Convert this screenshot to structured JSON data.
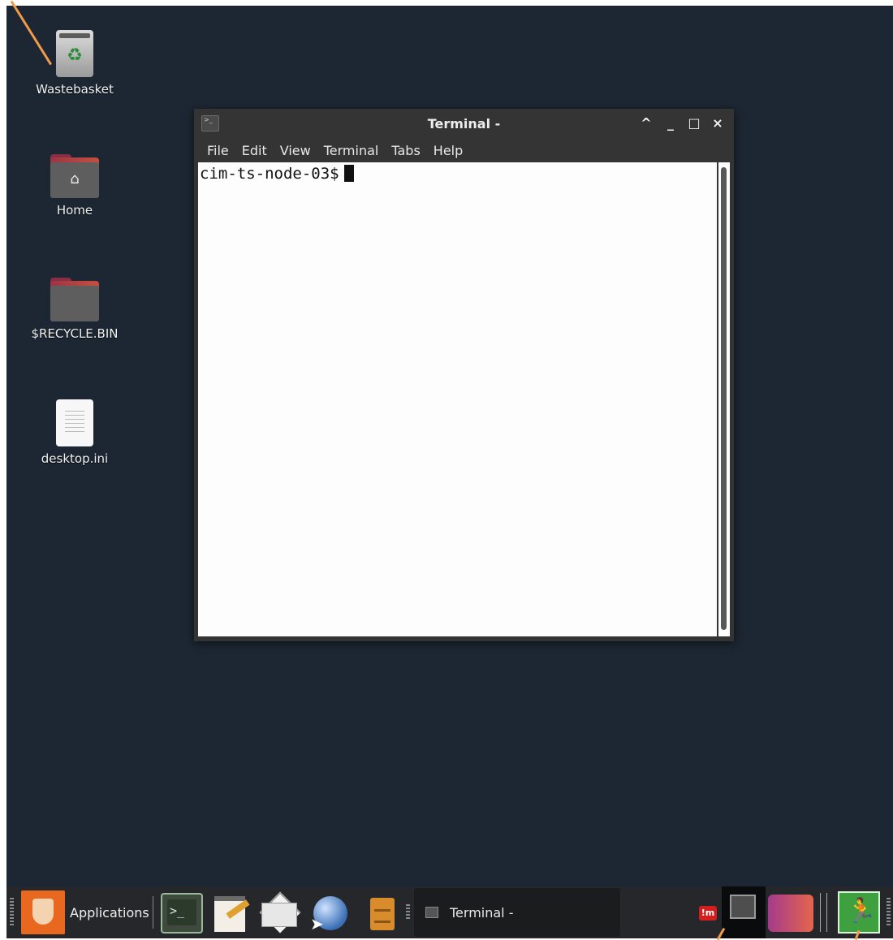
{
  "desktop": {
    "icons": [
      {
        "label": "Wastebasket"
      },
      {
        "label": "Home"
      },
      {
        "label": "$RECYCLE.BIN"
      },
      {
        "label": "desktop.ini"
      }
    ]
  },
  "terminal_window": {
    "title": "Terminal -",
    "buttons": {
      "up": "^",
      "minimize": "_",
      "maximize": "□",
      "close": "×"
    },
    "menu": [
      "File",
      "Edit",
      "View",
      "Terminal",
      "Tabs",
      "Help"
    ],
    "prompt": "cim-ts-node-03$"
  },
  "taskbar": {
    "applications_label": "Applications",
    "launchers": [
      "terminal-launcher-icon",
      "text-editor-icon",
      "mail-icon",
      "web-browser-icon",
      "file-manager-icon"
    ],
    "task_item_label": "Terminal -",
    "indicator_text": "!m",
    "colors": {
      "panel": "#25272a",
      "desktop": "#1c2733",
      "accent": "#e8681f",
      "annotation_arrow": "#f09a4a"
    }
  }
}
